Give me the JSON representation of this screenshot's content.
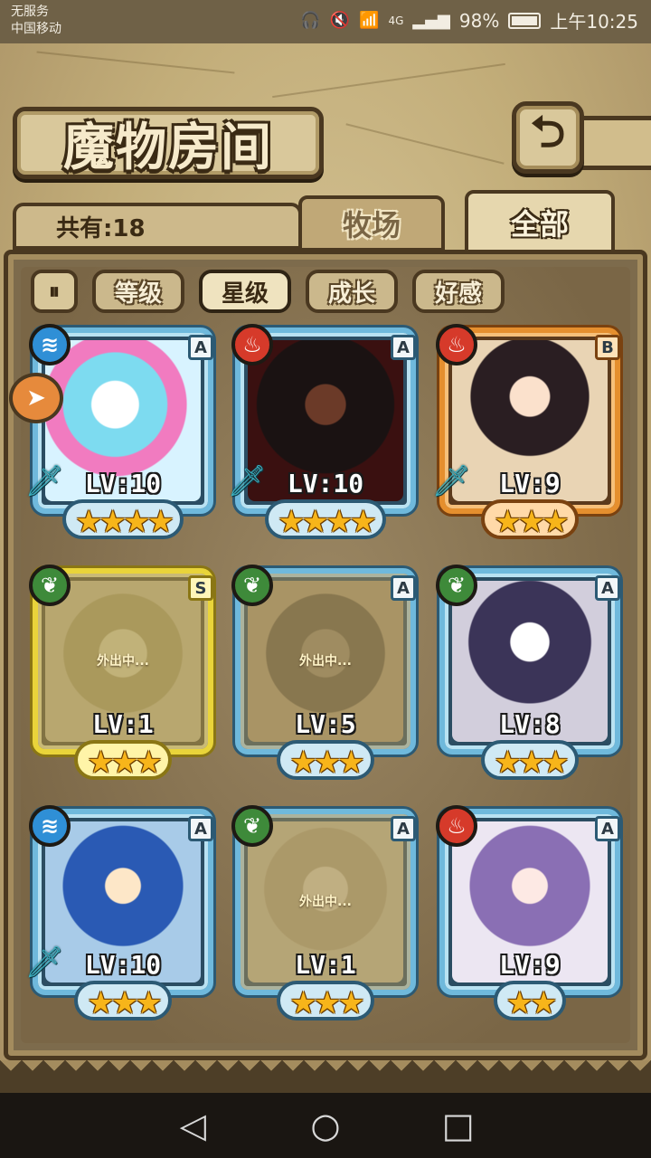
{
  "status_bar": {
    "carrier_line1": "无服务",
    "carrier_line2": "中国移动",
    "network": "4G",
    "battery": "98%",
    "battery_level": 0.98,
    "time": "上午10:25"
  },
  "header": {
    "title": "魔物房间",
    "back_icon": "back-arrow-icon"
  },
  "summary": {
    "count_label": "共有:18"
  },
  "tabs": [
    {
      "label": "牧场",
      "active": false
    },
    {
      "label": "全部",
      "active": true
    }
  ],
  "filters": {
    "pause_icon": "pause-icon",
    "items": [
      {
        "label": "等级",
        "active": false
      },
      {
        "label": "星级",
        "active": true
      },
      {
        "label": "成长",
        "active": false
      },
      {
        "label": "好感",
        "active": false
      }
    ]
  },
  "monsters": [
    {
      "element": "water",
      "element_icon": "≋",
      "rank": "A",
      "level": "LV:10",
      "stars": "★★★★",
      "star_count": 4,
      "has_sword": true,
      "away": false,
      "frame": "blue"
    },
    {
      "element": "fire",
      "element_icon": "♨",
      "rank": "A",
      "level": "LV:10",
      "stars": "★★★★",
      "star_count": 4,
      "has_sword": true,
      "away": false,
      "frame": "blue"
    },
    {
      "element": "fire",
      "element_icon": "♨",
      "rank": "B",
      "level": "LV:9",
      "stars": "★★★",
      "star_count": 3,
      "has_sword": true,
      "away": false,
      "frame": "orange"
    },
    {
      "element": "nature",
      "element_icon": "❦",
      "rank": "S",
      "level": "LV:1",
      "stars": "★★★",
      "star_count": 3,
      "has_sword": false,
      "away": true,
      "away_text": "外出中...",
      "frame": "gold"
    },
    {
      "element": "nature",
      "element_icon": "❦",
      "rank": "A",
      "level": "LV:5",
      "stars": "★★★",
      "star_count": 3,
      "has_sword": false,
      "away": true,
      "away_text": "外出中...",
      "frame": "blue"
    },
    {
      "element": "nature",
      "element_icon": "❦",
      "rank": "A",
      "level": "LV:8",
      "stars": "★★★",
      "star_count": 3,
      "has_sword": false,
      "away": false,
      "frame": "blue"
    },
    {
      "element": "water",
      "element_icon": "≋",
      "rank": "A",
      "level": "LV:10",
      "stars": "★★★",
      "star_count": 3,
      "has_sword": true,
      "away": false,
      "frame": "blue"
    },
    {
      "element": "nature",
      "element_icon": "❦",
      "rank": "A",
      "level": "LV:1",
      "stars": "★★★",
      "star_count": 3,
      "has_sword": false,
      "away": true,
      "away_text": "外出中...",
      "frame": "blue"
    },
    {
      "element": "fire",
      "element_icon": "♨",
      "rank": "A",
      "level": "LV:9",
      "stars": "★★",
      "star_count": 2,
      "has_sword": false,
      "away": false,
      "frame": "blue"
    }
  ],
  "navbar": {
    "back": "◁",
    "home": "○",
    "recent": "□"
  },
  "colors": {
    "water": "#2f8fd6",
    "fire": "#d63a2a",
    "nature": "#3e8a3a",
    "star": "#f7b51a"
  }
}
